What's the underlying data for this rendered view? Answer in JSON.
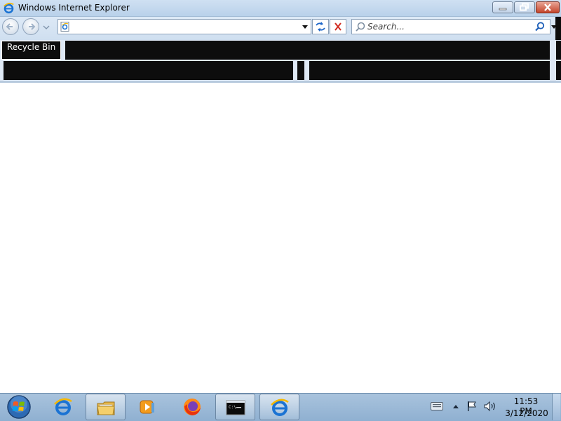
{
  "window": {
    "title": "Windows Internet Explorer"
  },
  "address_bar": {
    "value": ""
  },
  "search": {
    "placeholder": "Search..."
  },
  "desktop": {
    "recycle_bin_label": "Recycle Bin"
  },
  "taskbar": {
    "items": [
      "internet-explorer",
      "windows-explorer",
      "windows-media-player",
      "firefox",
      "command-prompt",
      "internet-explorer"
    ],
    "active_items": [
      "windows-explorer",
      "command-prompt",
      "internet-explorer"
    ]
  },
  "clock": {
    "time": "11:53 PM",
    "date": "3/12/2020"
  },
  "colors": {
    "titlebar": "#c4d9ef",
    "taskbar": "#9db9d8",
    "dark_panel": "#0d0d0d",
    "close_button": "#c4452b"
  }
}
